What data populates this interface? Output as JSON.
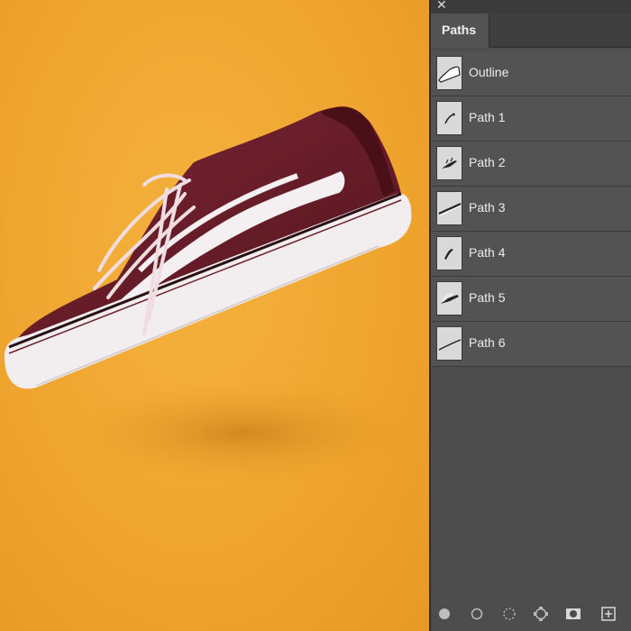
{
  "panel": {
    "close_icon": "close-icon",
    "tab_label": "Paths",
    "paths": [
      {
        "label": "Outline",
        "icon": "outline-path-thumbnail"
      },
      {
        "label": "Path 1",
        "icon": "path-thumbnail"
      },
      {
        "label": "Path 2",
        "icon": "path-thumbnail"
      },
      {
        "label": "Path 3",
        "icon": "path-thumbnail"
      },
      {
        "label": "Path 4",
        "icon": "path-thumbnail"
      },
      {
        "label": "Path 5",
        "icon": "path-thumbnail"
      },
      {
        "label": "Path 6",
        "icon": "path-thumbnail"
      }
    ],
    "bottom_buttons": [
      "fill-path-icon",
      "stroke-path-icon",
      "load-selection-icon",
      "make-work-path-icon",
      "add-mask-icon",
      "new-path-icon"
    ]
  },
  "canvas": {
    "background_color": "#f0a832",
    "shoe_color": "#6b1f2a",
    "sole_color": "#f2eef0"
  }
}
